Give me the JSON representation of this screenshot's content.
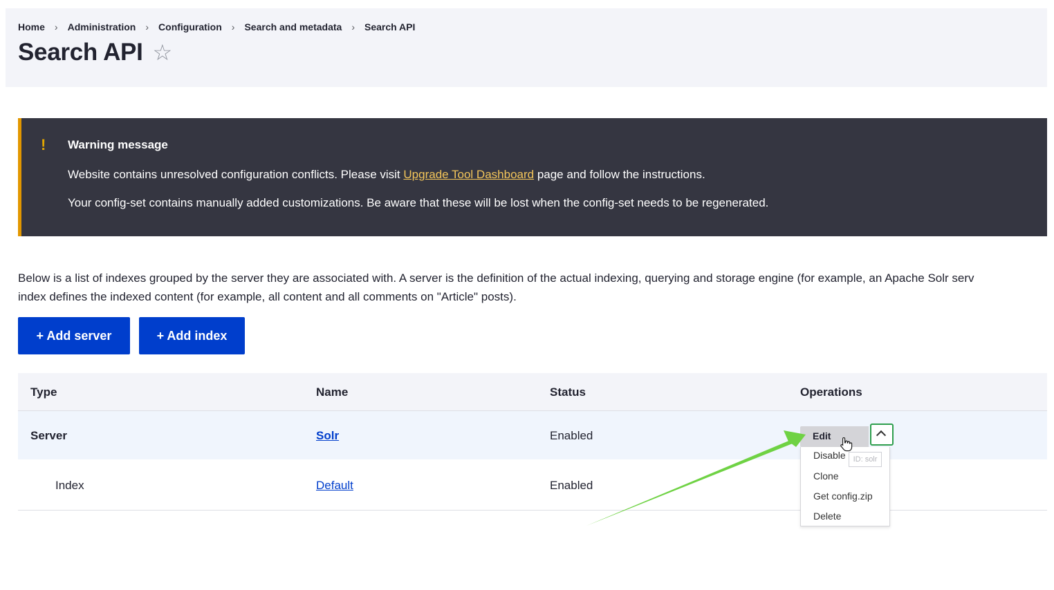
{
  "breadcrumb": [
    "Home",
    "Administration",
    "Configuration",
    "Search and metadata",
    "Search API"
  ],
  "breadcrumb_separator": "›",
  "page": {
    "title": "Search API",
    "favorite_icon": "☆"
  },
  "warning": {
    "icon": "!",
    "title": "Warning message",
    "line1_before": "Website contains unresolved configuration conflicts. Please visit ",
    "line1_link": "Upgrade Tool Dashboard",
    "line1_after": " page and follow the instructions.",
    "line2": "Your config-set contains manually added customizations. Be aware that these will be lost when the config-set needs to be regenerated."
  },
  "description": {
    "line1": "Below is a list of indexes grouped by the server they are associated with. A server is the definition of the actual indexing, querying and storage engine (for example, an Apache Solr serv",
    "line2": "index defines the indexed content (for example, all content and all comments on \"Article\" posts)."
  },
  "actions": {
    "add_server": "+ Add server",
    "add_index": "+ Add index"
  },
  "table": {
    "headers": {
      "type": "Type",
      "name": "Name",
      "status": "Status",
      "operations": "Operations"
    },
    "rows": [
      {
        "type": "Server",
        "name": "Solr",
        "status": "Enabled"
      },
      {
        "type": "Index",
        "name": "Default",
        "status": "Enabled"
      }
    ]
  },
  "operations": {
    "primary": "Edit",
    "menu": [
      "Disable",
      "Clone",
      "Get config.zip",
      "Delete"
    ],
    "tooltip": "ID: solr"
  },
  "colors": {
    "primary_button": "#003ecc",
    "warning_bg": "#353641",
    "warning_accent": "#e29700",
    "annotation_arrow": "#6fd244"
  }
}
